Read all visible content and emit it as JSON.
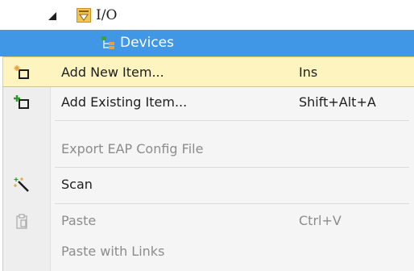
{
  "tree": {
    "io_label": "I/O",
    "io_icon": "io-folder-icon",
    "expander_icon": "expanded-triangle-icon",
    "devices_label": "Devices",
    "devices_icon": "devices-tree-icon",
    "selection_color": "#3f97e6"
  },
  "context_menu": {
    "highlight_color": "#fdf4bf",
    "items": [
      {
        "label": "Add New Item...",
        "shortcut": "Ins",
        "icon": "add-new-item-icon",
        "enabled": true,
        "highlighted": true
      },
      {
        "label": "Add Existing Item...",
        "shortcut": "Shift+Alt+A",
        "icon": "add-existing-item-icon",
        "enabled": true,
        "highlighted": false
      },
      {
        "label": "Export EAP Config File",
        "shortcut": "",
        "icon": "",
        "enabled": false,
        "highlighted": false
      },
      {
        "label": "Scan",
        "shortcut": "",
        "icon": "scan-wand-icon",
        "enabled": true,
        "highlighted": false
      },
      {
        "label": "Paste",
        "shortcut": "Ctrl+V",
        "icon": "paste-icon",
        "enabled": false,
        "highlighted": false
      },
      {
        "label": "Paste with Links",
        "shortcut": "",
        "icon": "",
        "enabled": false,
        "highlighted": false
      }
    ]
  }
}
